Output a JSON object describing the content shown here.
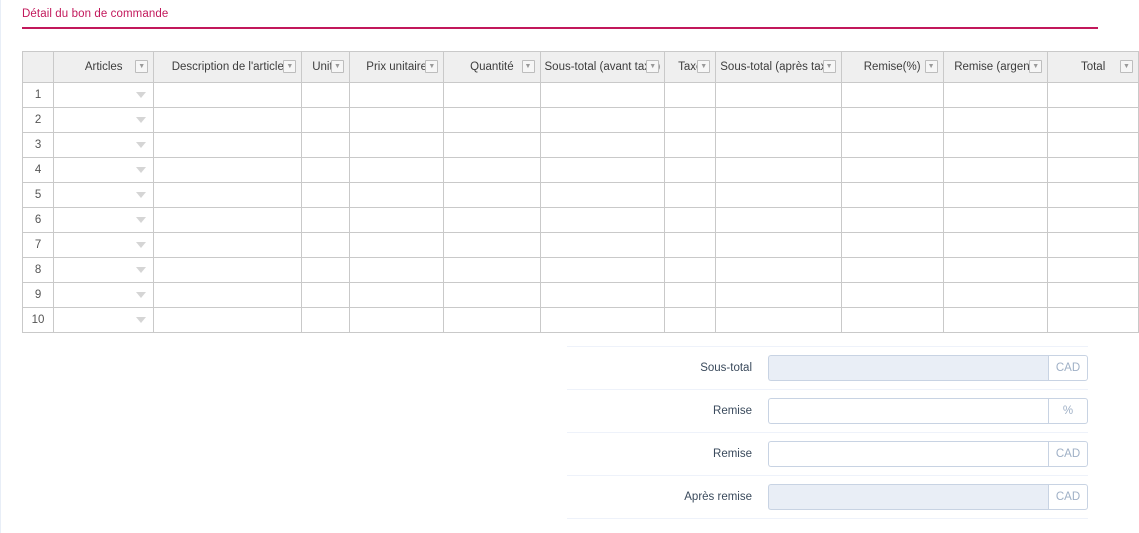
{
  "section": {
    "title": "Détail du bon de commande"
  },
  "grid": {
    "columns": [
      {
        "key": "rownum",
        "label": "",
        "width": 32,
        "filter": false
      },
      {
        "key": "articles",
        "label": "Articles",
        "width": 105,
        "filter": true
      },
      {
        "key": "desc",
        "label": "Description de l'article",
        "width": 150,
        "filter": true
      },
      {
        "key": "unite",
        "label": "Unité",
        "width": 48,
        "filter": true
      },
      {
        "key": "prix",
        "label": "Prix unitaire",
        "width": 96,
        "filter": true
      },
      {
        "key": "qte",
        "label": "Quantité",
        "width": 100,
        "filter": true
      },
      {
        "key": "st_avant",
        "label": "Sous-total (avant taxe)",
        "width": 95,
        "filter": true
      },
      {
        "key": "taxe",
        "label": "Taxe",
        "width": 52,
        "filter": true
      },
      {
        "key": "st_apres",
        "label": "Sous-total (après taxe)",
        "width": 95,
        "filter": true
      },
      {
        "key": "rem_pct",
        "label": "Remise(%)",
        "width": 105,
        "filter": true
      },
      {
        "key": "rem_arg",
        "label": "Remise (argent)",
        "width": 105,
        "filter": true
      },
      {
        "key": "total",
        "label": "Total",
        "width": 96,
        "filter": true
      }
    ],
    "rows": [
      {
        "num": "1"
      },
      {
        "num": "2"
      },
      {
        "num": "3"
      },
      {
        "num": "4"
      },
      {
        "num": "5"
      },
      {
        "num": "6"
      },
      {
        "num": "7"
      },
      {
        "num": "8"
      },
      {
        "num": "9"
      },
      {
        "num": "10"
      }
    ],
    "filter_icon": "▼",
    "cell_dropdown_icon": "caret-down-icon"
  },
  "totals": [
    {
      "label": "Sous-total",
      "value": "",
      "suffix": "CAD",
      "readonly": true
    },
    {
      "label": "Remise",
      "value": "",
      "suffix": "%",
      "readonly": false
    },
    {
      "label": "Remise",
      "value": "",
      "suffix": "CAD",
      "readonly": false
    },
    {
      "label": "Après remise",
      "value": "",
      "suffix": "CAD",
      "readonly": true
    }
  ],
  "colors": {
    "accent": "#c2185b",
    "grid_border": "#c9c9c9",
    "header_bg": "#efefef",
    "readonly_bg": "#e9eef6",
    "field_border": "#c8d3e3"
  }
}
